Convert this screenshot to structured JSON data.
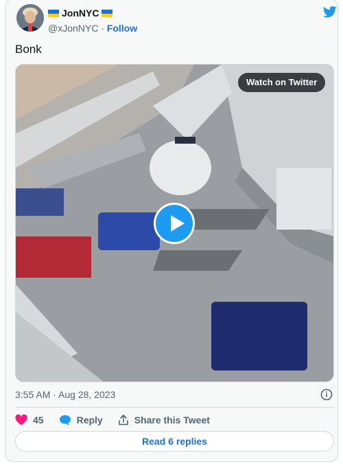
{
  "author": {
    "name": "JonNYC",
    "handle": "@xJonNYC",
    "separator": "·",
    "follow_label": "Follow"
  },
  "tweet": {
    "text": "Bonk",
    "timestamp": "3:55 AM · Aug 28, 2023"
  },
  "media": {
    "watch_label": "Watch on Twitter"
  },
  "actions": {
    "like_count": "45",
    "reply_label": "Reply",
    "share_label": "Share this Tweet"
  },
  "footer": {
    "read_replies_label": "Read 6 replies"
  },
  "colors": {
    "link": "#1d6fd6",
    "play": "#1d9bf0",
    "like": "#f91880",
    "reply_icon": "#1d9bf0"
  },
  "icons": [
    "verified-flag-icon",
    "twitter-bird-icon",
    "play-icon",
    "info-icon",
    "heart-icon",
    "reply-bubble-icon",
    "share-icon"
  ]
}
